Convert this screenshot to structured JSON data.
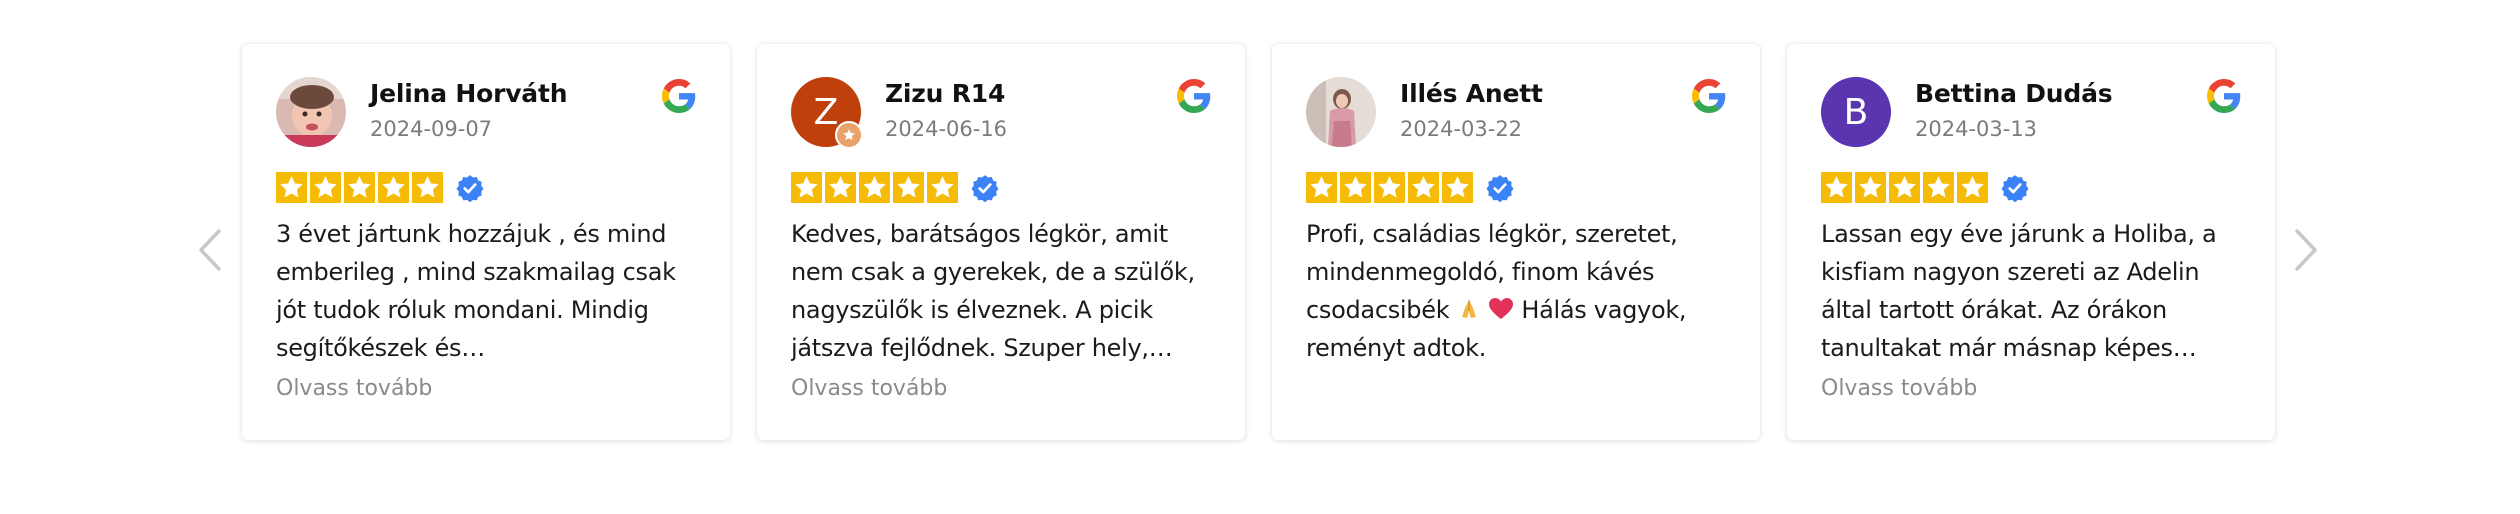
{
  "colors": {
    "star": "#f6bb06",
    "verified": "#3b82f6",
    "muted_text": "#7b7b7b",
    "arrow": "#c8c8c8"
  },
  "icons": {
    "prev": "chevron-left-icon",
    "next": "chevron-right-icon",
    "source": "google-icon",
    "rating": "star-icon",
    "verified": "verified-badge-icon"
  },
  "reviews": [
    {
      "name": "Jelina Horváth",
      "date": "2024-09-07",
      "rating": 5,
      "text": "3 évet jártunk hozzájuk , és mind emberileg , mind szakmailag csak jót tudok róluk mondani. Mindig segítőkészek és…",
      "read_more": "Olvass tovább",
      "avatar": "photo"
    },
    {
      "name": "Zizu R14",
      "date": "2024-06-16",
      "rating": 5,
      "text": "Kedves, barátságos légkör, amit nem csak a gyerekek, de a szülők, nagyszülők is élveznek. A picik játszva fejlődnek. Szuper hely,…",
      "read_more": "Olvass tovább",
      "avatar_letter": "Z",
      "avatar_color": "#c0400b"
    },
    {
      "name": "Illés Anett",
      "date": "2024-03-22",
      "rating": 5,
      "text": "Profi, családias légkör, szeretet, mindenmegoldó, finom kávés csodacsibék",
      "text_end": "Hálás vagyok, reményt adtok.",
      "avatar": "photo"
    },
    {
      "name": "Bettina Dudás",
      "date": "2024-03-13",
      "rating": 5,
      "text": "Lassan egy éve járunk a Holiba, a kisfiam nagyon szereti az Adelin által tartott órákat. Az órákon tanultakat már másnap képes…",
      "read_more": "Olvass tovább",
      "avatar_letter": "B",
      "avatar_color": "#5a35b0"
    }
  ]
}
